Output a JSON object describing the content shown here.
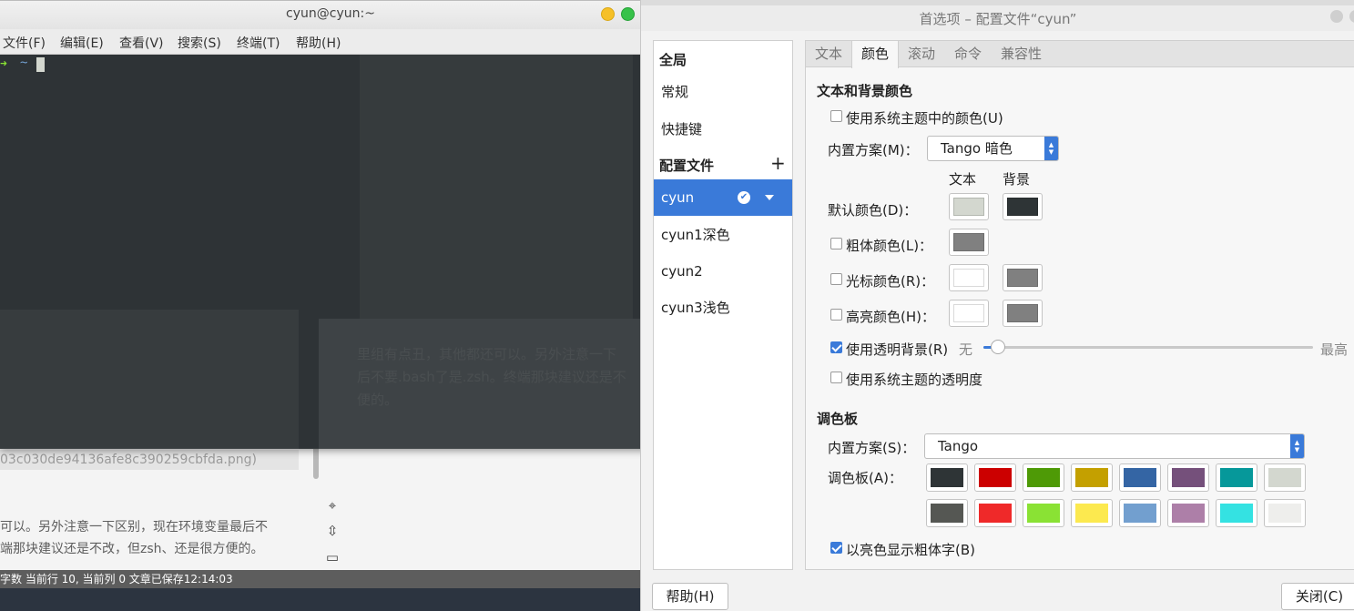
{
  "background_editor": {
    "filename": "03c030de94136afe8c390259cbfda.png)",
    "text_line1": "可以。另外注意一下区别，现在环境变量最后不",
    "text_line2": "端那块建议还是不改，但zsh、还是很方便的。",
    "ghost_para1": "里组有点丑，其他都还可以。另外注意一下",
    "ghost_para2": "后不要.bash了是.zsh。终端那块建议还是不",
    "ghost_para3": "便的。",
    "statusbar": "字数  当前行 10, 当前列 0  文章已保存12:14:03"
  },
  "terminal": {
    "title": "cyun@cyun:~",
    "menu": [
      "文件(F)",
      "编辑(E)",
      "查看(V)",
      "搜索(S)",
      "终端(T)",
      "帮助(H)"
    ],
    "prompt_arrow": "➜",
    "prompt_dir": "~",
    "colors": {
      "background": "#2e3436",
      "arrow": "#8ae234",
      "dir": "#729fcf"
    }
  },
  "preferences": {
    "title": "首选项 – 配置文件“cyun”",
    "sidebar": {
      "global_header": "全局",
      "general": "常规",
      "shortcuts": "快捷键",
      "profiles_header": "配置文件",
      "add_symbol": "+",
      "profiles": [
        "cyun",
        "cyun1深色",
        "cyun2",
        "cyun3浅色"
      ],
      "selected_profile": "cyun",
      "default_mark": "✔"
    },
    "tabs": [
      "文本",
      "颜色",
      "滚动",
      "命令",
      "兼容性"
    ],
    "active_tab": "颜色",
    "text_bg": {
      "section_title": "文本和背景颜色",
      "use_system_theme_colors": {
        "label": "使用系统主题中的颜色(U)",
        "checked": false
      },
      "builtin_scheme_label": "内置方案(M)：",
      "builtin_scheme_value": "Tango 暗色",
      "col_text": "文本",
      "col_bg": "背景",
      "default_color": {
        "label": "默认颜色(D)：",
        "text": "#d3d7cf",
        "bg": "#2e3436"
      },
      "bold_color": {
        "label": "粗体颜色(L)：",
        "checked": false,
        "text": "#808080"
      },
      "cursor_color": {
        "label": "光标颜色(R)：",
        "checked": false,
        "text": "#ffffff",
        "bg": "#808080"
      },
      "highlight_color": {
        "label": "高亮颜色(H)：",
        "checked": false,
        "text": "#ffffff",
        "bg": "#808080"
      },
      "transparent_bg": {
        "label": "使用透明背景(R)",
        "checked": true,
        "min_label": "无",
        "max_label": "最高",
        "value": 0.04
      },
      "system_transparency": {
        "label": "使用系统主题的透明度",
        "checked": false
      }
    },
    "palette": {
      "section_title": "调色板",
      "builtin_scheme_label": "内置方案(S)：",
      "builtin_scheme_value": "Tango",
      "palette_label": "调色板(A)：",
      "row1": [
        "#2e3436",
        "#cc0000",
        "#4e9a06",
        "#c4a000",
        "#3465a4",
        "#75507b",
        "#06989a",
        "#d3d7cf"
      ],
      "row2": [
        "#555753",
        "#ef2929",
        "#8ae234",
        "#fce94f",
        "#729fcf",
        "#ad7fa8",
        "#34e2e2",
        "#eeeeec"
      ],
      "bold_bright": {
        "label": "以亮色显示粗体字(B)",
        "checked": true
      }
    },
    "buttons": {
      "help": "帮助(H)",
      "close": "关闭(C)"
    },
    "accent": "#3a7ad9"
  }
}
